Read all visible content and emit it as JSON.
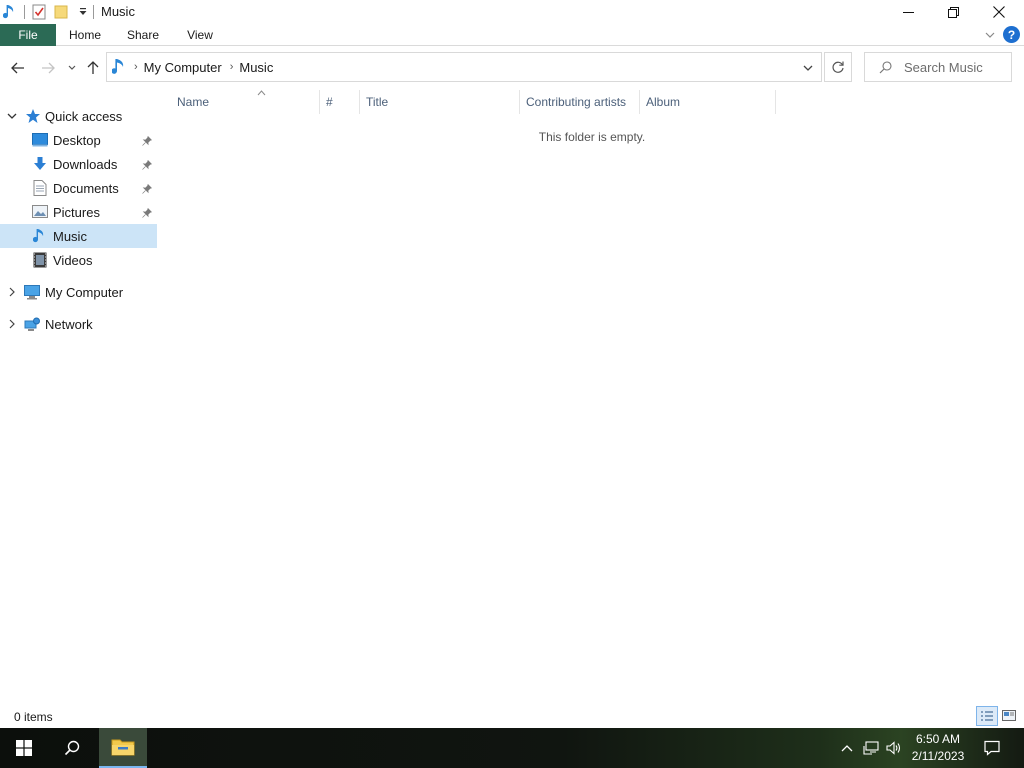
{
  "window": {
    "title": "Music",
    "controls": {
      "minimize": "minimize",
      "restore": "restore",
      "close": "close"
    }
  },
  "ribbon": {
    "tabs": [
      "File",
      "Home",
      "Share",
      "View"
    ]
  },
  "address": {
    "crumbs": [
      "My Computer",
      "Music"
    ],
    "search_placeholder": "Search Music"
  },
  "sidebar": {
    "quick_access": "Quick access",
    "items": [
      {
        "label": "Desktop",
        "icon": "desktop-icon",
        "pinned": true
      },
      {
        "label": "Downloads",
        "icon": "downloads-icon",
        "pinned": true
      },
      {
        "label": "Documents",
        "icon": "documents-icon",
        "pinned": true
      },
      {
        "label": "Pictures",
        "icon": "pictures-icon",
        "pinned": true
      },
      {
        "label": "Music",
        "icon": "music-icon",
        "pinned": false,
        "selected": true
      },
      {
        "label": "Videos",
        "icon": "videos-icon",
        "pinned": false
      }
    ],
    "my_computer": "My Computer",
    "network": "Network"
  },
  "content": {
    "columns": [
      "Name",
      "#",
      "Title",
      "Contributing artists",
      "Album"
    ],
    "empty_message": "This folder is empty."
  },
  "status": {
    "item_count": "0 items"
  },
  "taskbar": {
    "time": "6:50 AM",
    "date": "2/11/2023"
  },
  "colors": {
    "file_tab": "#2b6a55",
    "selection": "#cce4f7",
    "accent": "#1e6fd0"
  }
}
